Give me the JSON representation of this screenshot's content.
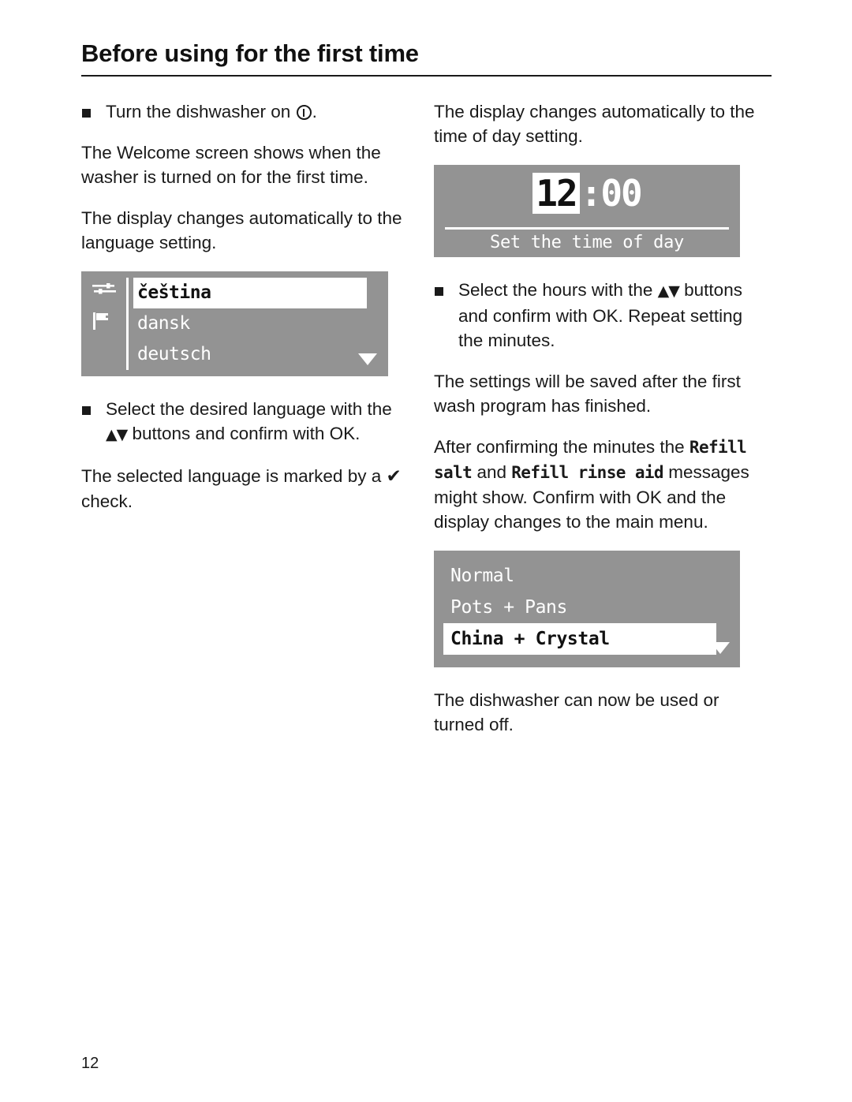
{
  "header": {
    "title": "Before using for the first time"
  },
  "left_column": {
    "step_power_on": {
      "text_before": "Turn the dishwasher on",
      "icon": "power-on-symbol",
      "text_after": "."
    },
    "paragraph_welcome": "The Welcome screen shows when the washer is turned on for the first time.",
    "paragraph_language_change": "The display changes automatically to the language setting.",
    "language_display": {
      "icons": [
        "settings-sliders-icon",
        "flag-icon"
      ],
      "rows": [
        {
          "label": "čeština",
          "selected": true
        },
        {
          "label": "dansk",
          "selected": false
        },
        {
          "label": "deutsch",
          "selected": false
        }
      ],
      "scroll_indicator": "down-arrow-icon"
    },
    "step_select_language": {
      "part1": "Select the desired language with the",
      "arrows": "▲▼",
      "part2": "buttons and confirm with OK."
    },
    "paragraph_check": {
      "part1": "The selected language is marked by a",
      "check": "✔",
      "part2": "check."
    }
  },
  "right_column": {
    "paragraph_time_change": "The display changes automatically to the time of day setting.",
    "clock_display": {
      "hours": "12",
      "separator_minutes": ":00",
      "caption": "Set the time of day"
    },
    "step_select_hours": {
      "part1": "Select the hours with the",
      "arrows": "▲▼",
      "part2": "buttons and confirm with OK. Repeat setting the minutes."
    },
    "paragraph_settings_saved": "The settings will be saved after the first wash program has finished.",
    "paragraph_refill": {
      "part1": "After confirming the minutes the",
      "term1": "Refill salt",
      "part2": "and",
      "term2": "Refill rinse aid",
      "part3": "messages might show. Confirm with OK and the display changes to the main menu."
    },
    "menu_display": {
      "rows": [
        {
          "label": "Normal",
          "selected": false
        },
        {
          "label": "Pots + Pans",
          "selected": false
        },
        {
          "label": "China + Crystal",
          "selected": true
        }
      ],
      "scroll_indicator": "down-arrow-icon"
    },
    "paragraph_ready": "The dishwasher can now be used or turned off."
  },
  "footer": {
    "page_number": "12"
  },
  "colors": {
    "display_background": "#939393",
    "display_text": "#ffffff",
    "text": "#1a1a1a",
    "page_background": "#ffffff"
  }
}
